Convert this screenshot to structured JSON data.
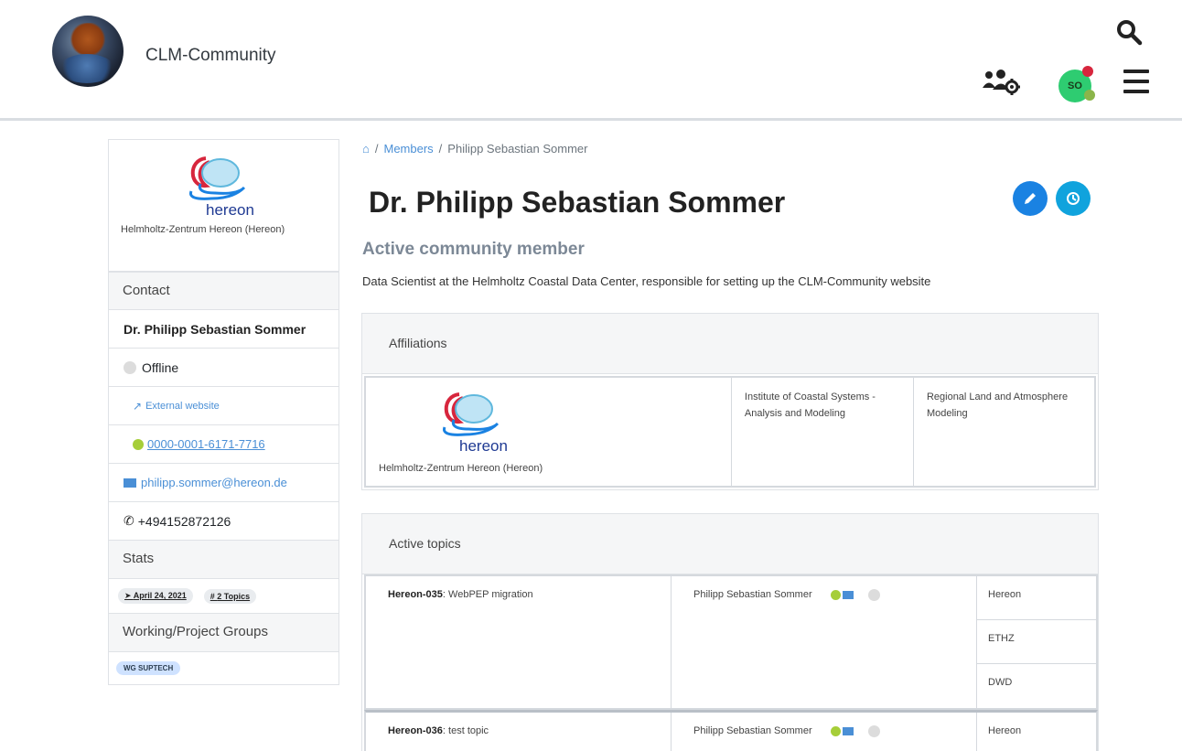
{
  "header": {
    "site_name": "CLM-Community",
    "avatar_initials": "SO",
    "icons": [
      "search-icon",
      "user-cog-icon",
      "menu-icon"
    ]
  },
  "sidebar": {
    "org_logo_text": "hereon",
    "org_caption": "Helmholtz-Zentrum Hereon (Hereon)",
    "contact_header": "Contact",
    "name": "Dr. Philipp Sebastian Sommer",
    "status": "Offline",
    "external_website": "External website",
    "orcid": "0000-0001-6171-7716",
    "email": "philipp.sommer@hereon.de",
    "phone": "+494152872126",
    "stats_header": "Stats",
    "stats_date": "April 24, 2021",
    "stats_topics": "2 Topics",
    "groups_header": "Working/Project Groups",
    "group_badge": "WG SUPTECH"
  },
  "breadcrumb": {
    "members": "Members",
    "current": "Philipp Sebastian Sommer"
  },
  "main": {
    "title": "Dr. Philipp Sebastian Sommer",
    "subtitle": "Active community member",
    "description": "Data Scientist at the Helmholtz Coastal Data Center, responsible for setting up the CLM-Community website"
  },
  "affiliations": {
    "header": "Affiliations",
    "org_logo_text": "hereon",
    "org_caption": "Helmholtz-Zentrum Hereon (Hereon)",
    "institute": "Institute of Coastal Systems - Analysis and Modeling",
    "department": "Regional Land and Atmosphere Modeling"
  },
  "topics": {
    "header": "Active topics",
    "rows": [
      {
        "id": "Hereon-035",
        "title": ": WebPEP migration",
        "person": "Philipp Sebastian Sommer",
        "orgs": [
          "Hereon",
          "ETHZ",
          "DWD"
        ]
      },
      {
        "id": "Hereon-036",
        "title": ": test topic",
        "person": "Philipp Sebastian Sommer",
        "orgs": [
          "Hereon"
        ]
      }
    ]
  },
  "colors": {
    "accent": "#1a82e2",
    "link": "#4a8fd6",
    "orcid": "#a6ce39",
    "online_avatar": "#2ecc71"
  }
}
